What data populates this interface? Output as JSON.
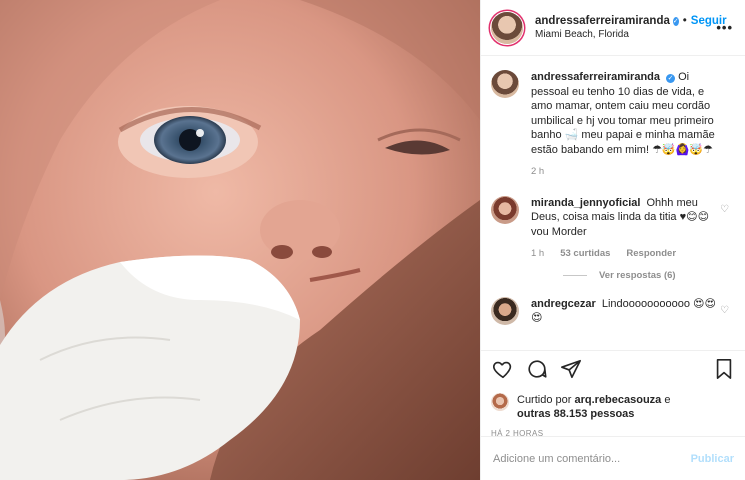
{
  "post": {
    "username": "andressaferreiramiranda",
    "verified_badge": "verified-icon",
    "separator": "•",
    "follow_label": "Seguir",
    "location": "Miami Beach, Florida",
    "more_label": "•••"
  },
  "caption": {
    "username": "andressaferreiramiranda",
    "text": "Oi pessoal eu tenho 10 dias de vida, e amo mamar, ontem caiu meu cordão umbilical e hj vou tomar meu primeiro banho 🛁 meu papai e minha mamãe estão babando em mim! ☂🤯🙆‍♀️🤯☂",
    "time": "2 h"
  },
  "comments": [
    {
      "username": "miranda_jennyoficial",
      "text": "Ohhh meu Deus, coisa mais linda da titia ♥😊😊 vou Morder",
      "time": "1 h",
      "likes": "53 curtidas",
      "reply_label": "Responder",
      "view_replies": "Ver respostas (6)"
    },
    {
      "username": "andregcezar",
      "text": "Lindooooooooooo 😍😍😍"
    }
  ],
  "liked_by": {
    "prefix": "Curtido por",
    "user": "arq.rebecasouza",
    "middle": "e",
    "others": "outras 88.153 pessoas"
  },
  "timestamp": "HÁ 2 HORAS",
  "comment_box": {
    "placeholder": "Adicione um comentário...",
    "publish_label": "Publicar"
  },
  "colors": {
    "accent": "#0095f6",
    "verified": "#3897f0",
    "muted": "#8e8e8e",
    "publish_disabled": "#b2dffc"
  }
}
